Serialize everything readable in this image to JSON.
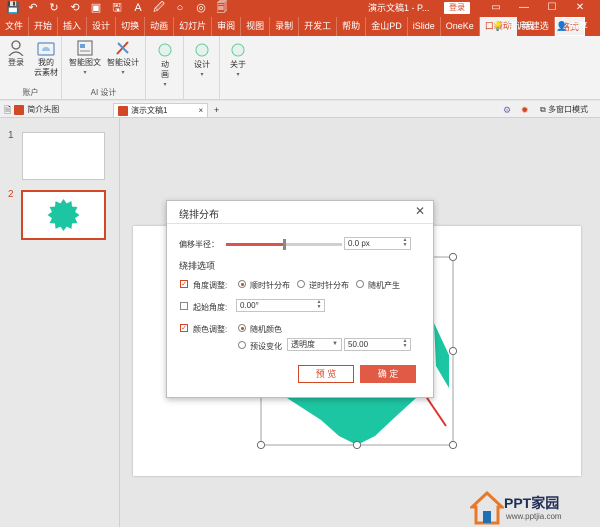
{
  "window": {
    "title": "演示文稿1 - P...",
    "login_label": "登录",
    "controls": [
      "▭",
      "—",
      "☐",
      "✕"
    ]
  },
  "quick_access": [
    "💾",
    "↶",
    "↻",
    "⟲",
    "▣",
    "🖫",
    "A",
    "🖉",
    "○",
    "◎",
    "🗐"
  ],
  "ribbon_tabs": [
    {
      "label": "文件",
      "state": "normal"
    },
    {
      "label": "开始",
      "state": "normal"
    },
    {
      "label": "插入",
      "state": "normal"
    },
    {
      "label": "设计",
      "state": "normal"
    },
    {
      "label": "切换",
      "state": "normal"
    },
    {
      "label": "动画",
      "state": "normal"
    },
    {
      "label": "幻灯片",
      "state": "normal"
    },
    {
      "label": "审阅",
      "state": "normal"
    },
    {
      "label": "视图",
      "state": "normal"
    },
    {
      "label": "录制",
      "state": "normal"
    },
    {
      "label": "开发工",
      "state": "normal"
    },
    {
      "label": "帮助",
      "state": "normal"
    },
    {
      "label": "金山PD",
      "state": "normal"
    },
    {
      "label": "iSlide",
      "state": "normal"
    },
    {
      "label": "OneKe",
      "state": "normal"
    },
    {
      "label": "口袋动",
      "state": "active"
    },
    {
      "label": "新建选",
      "state": "normal"
    },
    {
      "label": "格式",
      "state": "special"
    }
  ],
  "tell_me": "告诉我",
  "share": "共享",
  "ribbon": {
    "account_group": {
      "label": "账户",
      "buttons": [
        "登录",
        "我的\n云素材"
      ]
    },
    "ai_group": {
      "label": "AI 设计",
      "buttons": [
        "智能图文",
        "智能设计"
      ]
    },
    "btn_animation": "动\n画",
    "btn_design": "设计",
    "btn_about": "关于"
  },
  "doc_tabs": {
    "tab1": "简介头图",
    "tab2": "演示文稿1",
    "add": "+",
    "multi_window": "多窗口模式"
  },
  "slides": [
    {
      "number": "1",
      "selected": false
    },
    {
      "number": "2",
      "selected": true
    }
  ],
  "dialog": {
    "title": "绕排分布",
    "offset_label": "偏移半径：",
    "offset_value": "0.0 px",
    "offset_fraction": 0.5,
    "options_label": "绕排选项",
    "angle_adjust": {
      "label": "角度调整:",
      "checked": true
    },
    "radio_cw": {
      "label": "顺时针分布",
      "selected": true
    },
    "radio_ccw": {
      "label": "逆时针分布",
      "selected": false
    },
    "radio_random": {
      "label": "随机产生",
      "selected": false
    },
    "start_angle": {
      "label": "起始角度:",
      "checked": false,
      "value": "0.00°"
    },
    "color_adjust": {
      "label": "颜色调整:",
      "checked": true
    },
    "radio_random_color": {
      "label": "随机颜色",
      "selected": true
    },
    "radio_preset": {
      "label": "预设变化",
      "selected": false
    },
    "preset_select": "透明度",
    "preset_value": "50.00",
    "preview_button": "预 览",
    "ok_button": "确 定"
  },
  "shape_color": "#1dc6a3",
  "accent_color": "#d24726",
  "watermark": {
    "brand": "PPT家园",
    "url": "www.pptjia.com"
  }
}
